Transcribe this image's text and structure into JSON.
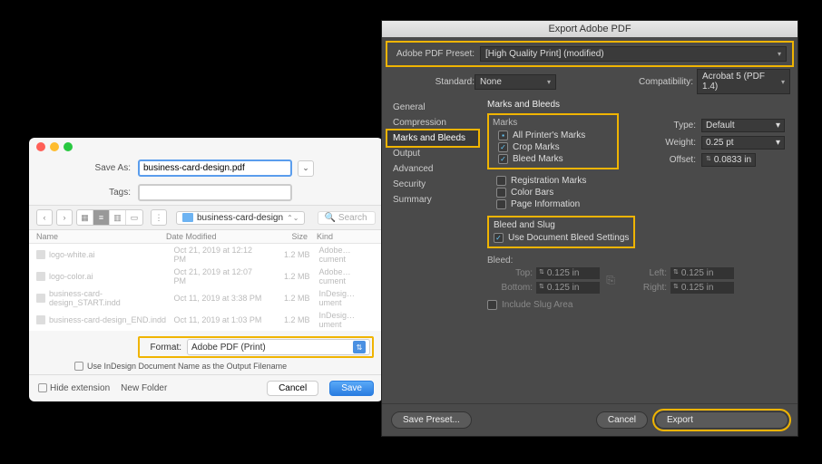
{
  "highlight_color": "#f0b400",
  "macDialog": {
    "trafficLights": [
      "#ff5f57",
      "#febc2e",
      "#28c840"
    ],
    "saveAsLabel": "Save As:",
    "saveAsValue": "business-card-design.pdf",
    "tagsLabel": "Tags:",
    "folderName": "business-card-design",
    "searchPlaceholder": "Search",
    "columns": {
      "name": "Name",
      "date": "Date Modified",
      "size": "Size",
      "kind": "Kind"
    },
    "files": [
      {
        "name": "logo-white.ai",
        "date": "Oct 21, 2019 at 12:12 PM",
        "size": "1.2 MB",
        "kind": "Adobe…cument"
      },
      {
        "name": "logo-color.ai",
        "date": "Oct 21, 2019 at 12:07 PM",
        "size": "1.2 MB",
        "kind": "Adobe…cument"
      },
      {
        "name": "business-card-design_START.indd",
        "date": "Oct 11, 2019 at 3:38 PM",
        "size": "1.2 MB",
        "kind": "InDesig…ument"
      },
      {
        "name": "business-card-design_END.indd",
        "date": "Oct 11, 2019 at 1:03 PM",
        "size": "1.2 MB",
        "kind": "InDesig…ument"
      }
    ],
    "formatLabel": "Format:",
    "formatValue": "Adobe PDF (Print)",
    "useNameCheckbox": "Use InDesign Document Name as the Output Filename",
    "hideExtension": "Hide extension",
    "newFolder": "New Folder",
    "cancel": "Cancel",
    "save": "Save"
  },
  "adobeDialog": {
    "title": "Export Adobe PDF",
    "presetLabel": "Adobe PDF Preset:",
    "presetValue": "[High Quality Print] (modified)",
    "standardLabel": "Standard:",
    "standardValue": "None",
    "compatLabel": "Compatibility:",
    "compatValue": "Acrobat 5 (PDF 1.4)",
    "sidebar": [
      "General",
      "Compression",
      "Marks and Bleeds",
      "Output",
      "Advanced",
      "Security",
      "Summary"
    ],
    "sidebarActiveIndex": 2,
    "sectionTitle": "Marks and Bleeds",
    "marksHeader": "Marks",
    "marks": {
      "allPrinters": "All Printer's Marks",
      "crop": "Crop Marks",
      "bleed": "Bleed Marks",
      "registration": "Registration Marks",
      "colorBars": "Color Bars",
      "pageInfo": "Page Information"
    },
    "typeLabel": "Type:",
    "typeValue": "Default",
    "weightLabel": "Weight:",
    "weightValue": "0.25 pt",
    "offsetLabel": "Offset:",
    "offsetValue": "0.0833 in",
    "bleedHeader": "Bleed and Slug",
    "useDocBleed": "Use Document Bleed Settings",
    "bleedSub": "Bleed:",
    "bleedVals": {
      "topL": "Top:",
      "top": "0.125 in",
      "bottomL": "Bottom:",
      "bottom": "0.125 in",
      "leftL": "Left:",
      "left": "0.125 in",
      "rightL": "Right:",
      "right": "0.125 in"
    },
    "includeSlug": "Include Slug Area",
    "savePreset": "Save Preset...",
    "cancel": "Cancel",
    "export": "Export"
  }
}
